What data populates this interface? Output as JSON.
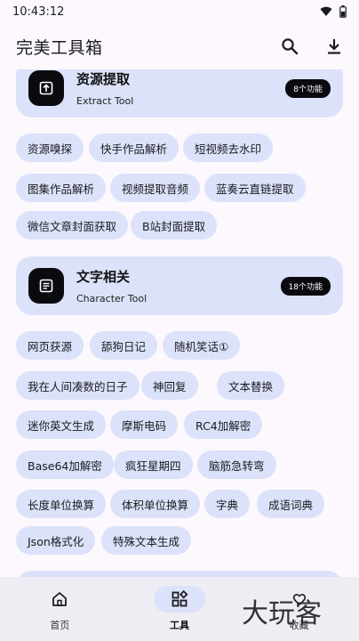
{
  "status_bar": {
    "time": "10:43:12"
  },
  "app_bar": {
    "title": "完美工具箱"
  },
  "sections": [
    {
      "title": "资源提取",
      "subtitle": "Extract Tool",
      "badge": "8个功能",
      "tools": [
        "资源嗅探",
        "快手作品解析",
        "短视频去水印",
        "图集作品解析",
        "视频提取音频",
        "蓝奏云直链提取",
        "微信文章封面获取",
        "B站封面提取"
      ]
    },
    {
      "title": "文字相关",
      "subtitle": "Character Tool",
      "badge": "18个功能",
      "tools": [
        "网页获源",
        "舔狗日记",
        "随机笑话①",
        "我在人间凑数的日子",
        "神回复",
        "文本替换",
        "迷你英文生成",
        "摩斯电码",
        "RC4加解密",
        "Base64加解密",
        "疯狂星期四",
        "脑筋急转弯",
        "长度单位换算",
        "体积单位换算",
        "字典",
        "成语词典",
        "Json格式化",
        "特殊文本生成"
      ]
    }
  ],
  "nav": [
    {
      "label": "首页",
      "icon": "home-icon",
      "active": false
    },
    {
      "label": "工具",
      "icon": "tools-grid-icon",
      "active": true
    },
    {
      "label": "收藏",
      "icon": "favorite-icon",
      "active": false
    }
  ],
  "watermark": "大玩客"
}
